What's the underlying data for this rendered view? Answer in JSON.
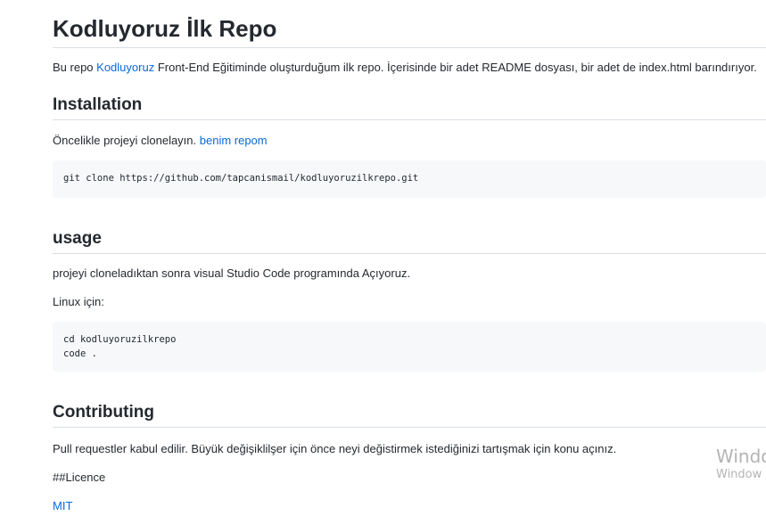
{
  "title": "Kodluyoruz İlk Repo",
  "intro": {
    "before": "Bu repo ",
    "link": "Kodluyoruz",
    "after": " Front-End Eğitiminde oluşturduğum ilk repo. İçerisinde bir adet README dosyası, bir adet de index.html barındırıyor."
  },
  "installation": {
    "heading": "Installation",
    "text": "Öncelikle projeyi clonelayın. ",
    "link": "benim repom",
    "code": "git clone https://github.com/tapcanismail/kodluyoruzilkrepo.git"
  },
  "usage": {
    "heading": "usage",
    "text": "projeyi cloneladıktan sonra visual Studio Code programında Açıyoruz.",
    "linux_label": "Linux için:",
    "code": "cd kodluyoruzilkrepo\ncode ."
  },
  "contributing": {
    "heading": "Contributing",
    "text": "Pull requestler kabul edilir. Büyük değişiklilşer için önce neyi değistirmek istediğinizi tartışmak için konu açınız.",
    "licence_label": "##Licence",
    "licence_link": "MIT"
  },
  "watermark": {
    "line1": "Windo",
    "line2": "Window"
  }
}
